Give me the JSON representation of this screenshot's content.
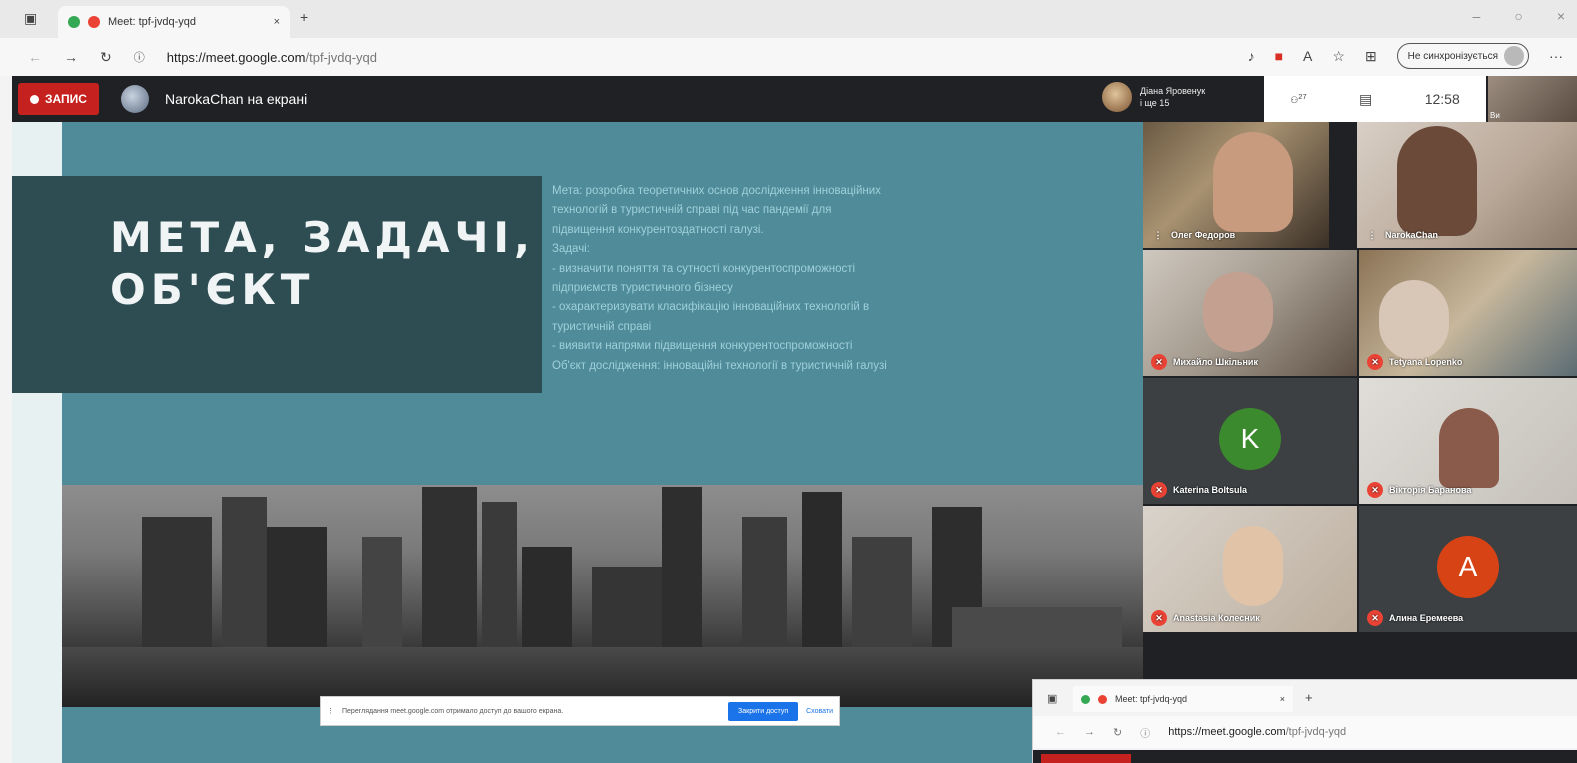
{
  "browser": {
    "tab_title": "Meet: tpf-jvdq-yqd",
    "new_tab_glyph": "+",
    "url_host": "https://meet.google.com",
    "url_path": "/tpf-jvdq-yqd",
    "sync_label": "Не синхронізується",
    "more_glyph": "···"
  },
  "meet": {
    "record_label": "ЗАПИС",
    "presenting_text": "NarokaChan на екрані",
    "top_user_name": "Діана Яровенук",
    "top_user_sub": "і ще 15",
    "participant_count": "27",
    "time": "12:58",
    "self_label": "Ви"
  },
  "slide": {
    "title": "МЕТА, ЗАДАЧІ,\nОБ'ЄКТ",
    "text_lines": [
      "Мета: розробка теоретичних основ дослідження інноваційних",
      "технологій в туристичній справі під час пандемії для",
      "підвищення конкурентоздатності галузі.",
      "Задачі:",
      "- визначити поняття та сутності конкурентоспроможності",
      "підприємств туристичного бізнесу",
      "- охарактеризувати класифікацію інноваційних технологій в",
      "туристичній справі",
      "- виявити напрями підвищення конкурентоспроможності",
      "Об'єкт дослідження: інноваційні технології в туристичній галузі"
    ]
  },
  "share_bar": {
    "message": "Переглядання meet.google.com отримало доступ до вашого екрана.",
    "stop_button": "Закрити доступ",
    "hide_button": "Сховати"
  },
  "participants": [
    {
      "name": "Олег Федоров",
      "initial": ""
    },
    {
      "name": "NarokaChan",
      "initial": ""
    },
    {
      "name": "Михайло Шкільник",
      "initial": ""
    },
    {
      "name": "Tetyana Lopenko",
      "initial": ""
    },
    {
      "name": "Katerina Boltsula",
      "initial": "K"
    },
    {
      "name": "Вікторія Баранова",
      "initial": ""
    },
    {
      "name": "Anastasia Колесник",
      "initial": ""
    },
    {
      "name": "Алина Еремеева",
      "initial": "A"
    }
  ],
  "colors": {
    "record_red": "#c5221f",
    "slide_teal": "#4f8b98",
    "title_box": "#2e4d52",
    "avatar_green": "#3c8a2e",
    "avatar_orange": "#d84315"
  }
}
